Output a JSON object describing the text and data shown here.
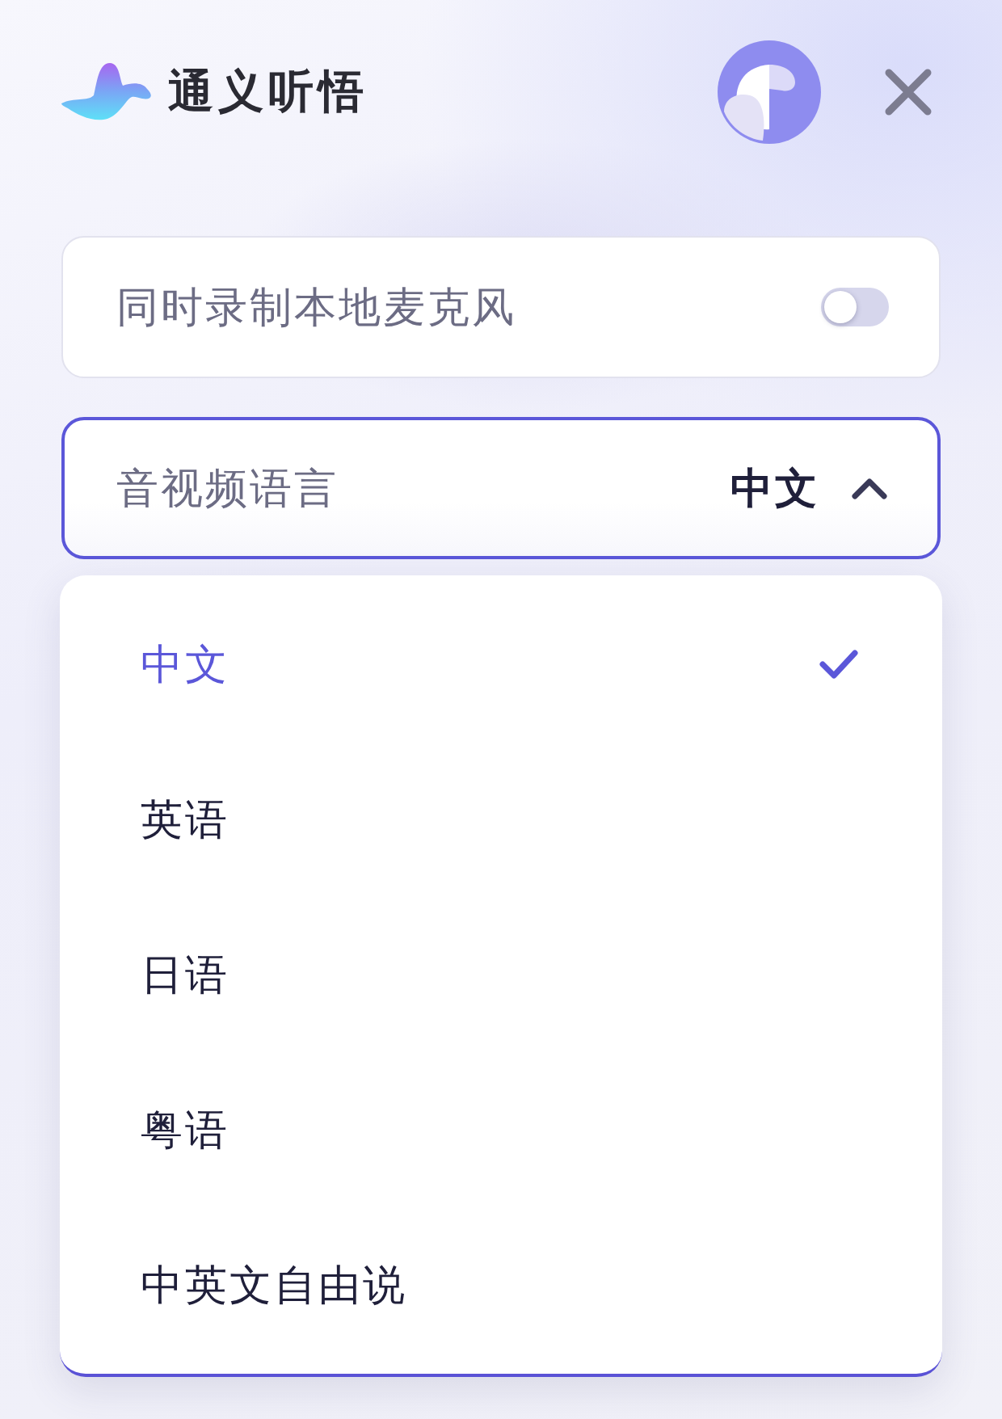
{
  "app": {
    "title": "通义听悟"
  },
  "mic_toggle": {
    "label": "同时录制本地麦克风",
    "on": false
  },
  "language_select": {
    "label": "音视频语言",
    "value": "中文",
    "expanded": true,
    "options": [
      {
        "label": "中文",
        "selected": true
      },
      {
        "label": "英语",
        "selected": false
      },
      {
        "label": "日语",
        "selected": false
      },
      {
        "label": "粤语",
        "selected": false
      },
      {
        "label": "中英文自由说",
        "selected": false
      }
    ]
  }
}
